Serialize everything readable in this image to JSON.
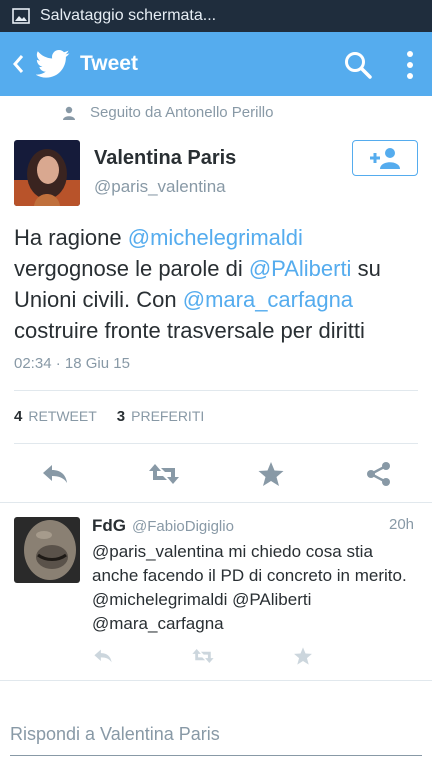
{
  "status_bar": {
    "notification": "Salvataggio schermata..."
  },
  "app_bar": {
    "title": "Tweet"
  },
  "social_context": "Seguito da Antonello Perillo",
  "tweet": {
    "author_name": "Valentina Paris",
    "author_handle": "@paris_valentina",
    "text_parts": {
      "p1": "Ha ragione ",
      "m1": "@michelegrimaldi",
      "p2": " vergognose le parole di ",
      "m2": "@PAliberti",
      "p3": " su Unioni civili. Con ",
      "m3": "@mara_carfagna",
      "p4": " costruire fronte trasversale per diritti"
    },
    "timestamp": "02:34 · 18 Giu 15",
    "retweet_count": "4",
    "retweet_label": "RETWEET",
    "favorite_count": "3",
    "favorite_label": "PREFERITI"
  },
  "reply": {
    "author_name": "FdG",
    "author_handle": "@FabioDigiglio",
    "time": "20h",
    "text": "@paris_valentina mi chiedo cosa stia anche facendo il PD di concreto in merito. @michelegrimaldi @PAliberti @mara_carfagna"
  },
  "reply_input": {
    "placeholder": "Rispondi a Valentina Paris"
  },
  "colors": {
    "brand": "#55acee",
    "text": "#292f33",
    "muted": "#8899a6",
    "status_bar": "#1f2d3d"
  }
}
